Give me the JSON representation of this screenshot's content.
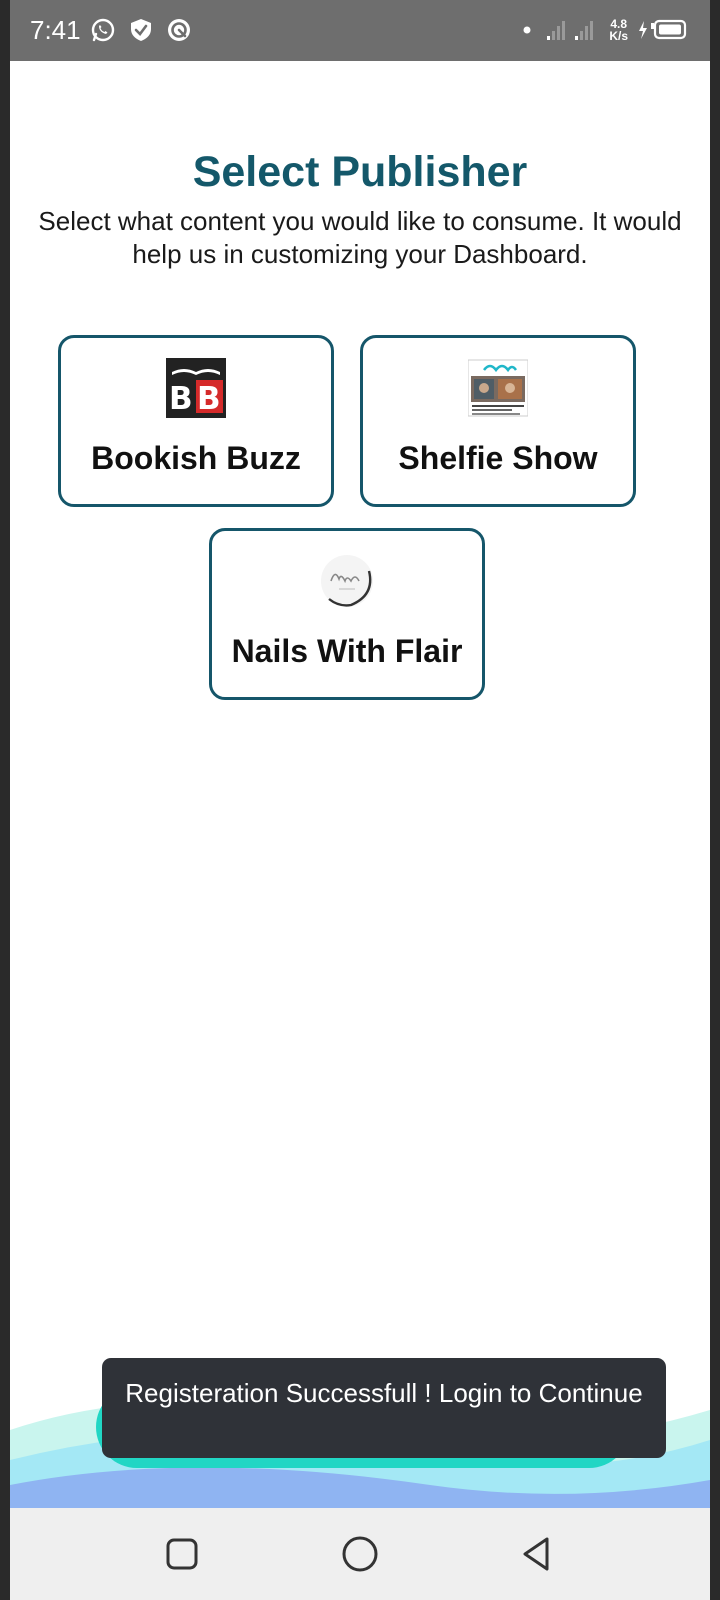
{
  "status_bar": {
    "time": "7:41",
    "net_speed_value": "4.8",
    "net_speed_unit": "K/s",
    "icons": [
      "whatsapp-icon",
      "shield-icon",
      "sync-app-icon",
      "signal-icon",
      "battery-charging-icon"
    ]
  },
  "header": {
    "title": "Select Publisher",
    "subtitle": "Select what content you would like to consume. It would help us in customizing your Dashboard."
  },
  "publishers": [
    {
      "label": "Bookish Buzz",
      "logo": "bookish-buzz-logo"
    },
    {
      "label": "Shelfie Show",
      "logo": "shelfie-show-logo"
    },
    {
      "label": "Nails With Flair",
      "logo": "nails-with-flair-logo"
    }
  ],
  "toast": {
    "message": "Registeration Successfull ! Login to Continue"
  },
  "nav_bar": {
    "buttons": [
      "recents-square-icon",
      "home-circle-icon",
      "back-triangle-icon"
    ]
  },
  "colors": {
    "accent": "#14586a",
    "card_border": "#15566a",
    "button_teal": "#21d6c4",
    "toast_bg": "#2f3238",
    "status_bar_bg": "#6e6e6e"
  }
}
